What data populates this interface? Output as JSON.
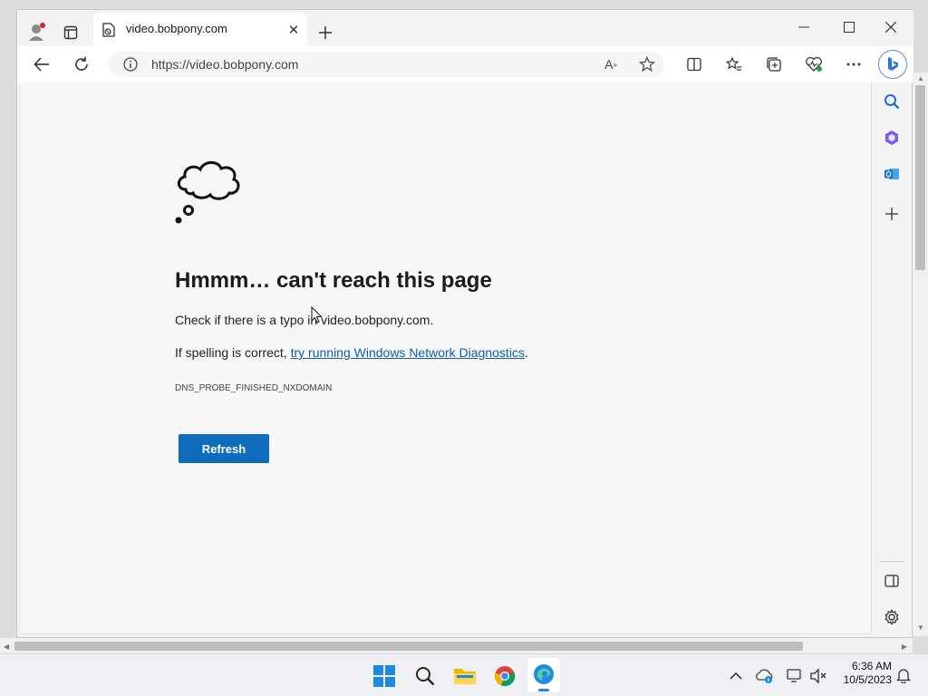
{
  "browser": {
    "tab": {
      "title": "video.bobpony.com"
    },
    "address": {
      "url": "https://video.bobpony.com"
    }
  },
  "page": {
    "heading": "Hmmm… can't reach this page",
    "line1": "Check if there is a typo in video.bobpony.com.",
    "line2_prefix": "If spelling is correct, ",
    "line2_link": "try running Windows Network Diagnostics",
    "line2_suffix": ".",
    "error_code": "DNS_PROBE_FINISHED_NXDOMAIN",
    "refresh_label": "Refresh"
  },
  "taskbar": {
    "time": "6:36 AM",
    "date": "10/5/2023"
  },
  "colors": {
    "accent": "#0f6cbd",
    "link": "#0f5ea8"
  }
}
